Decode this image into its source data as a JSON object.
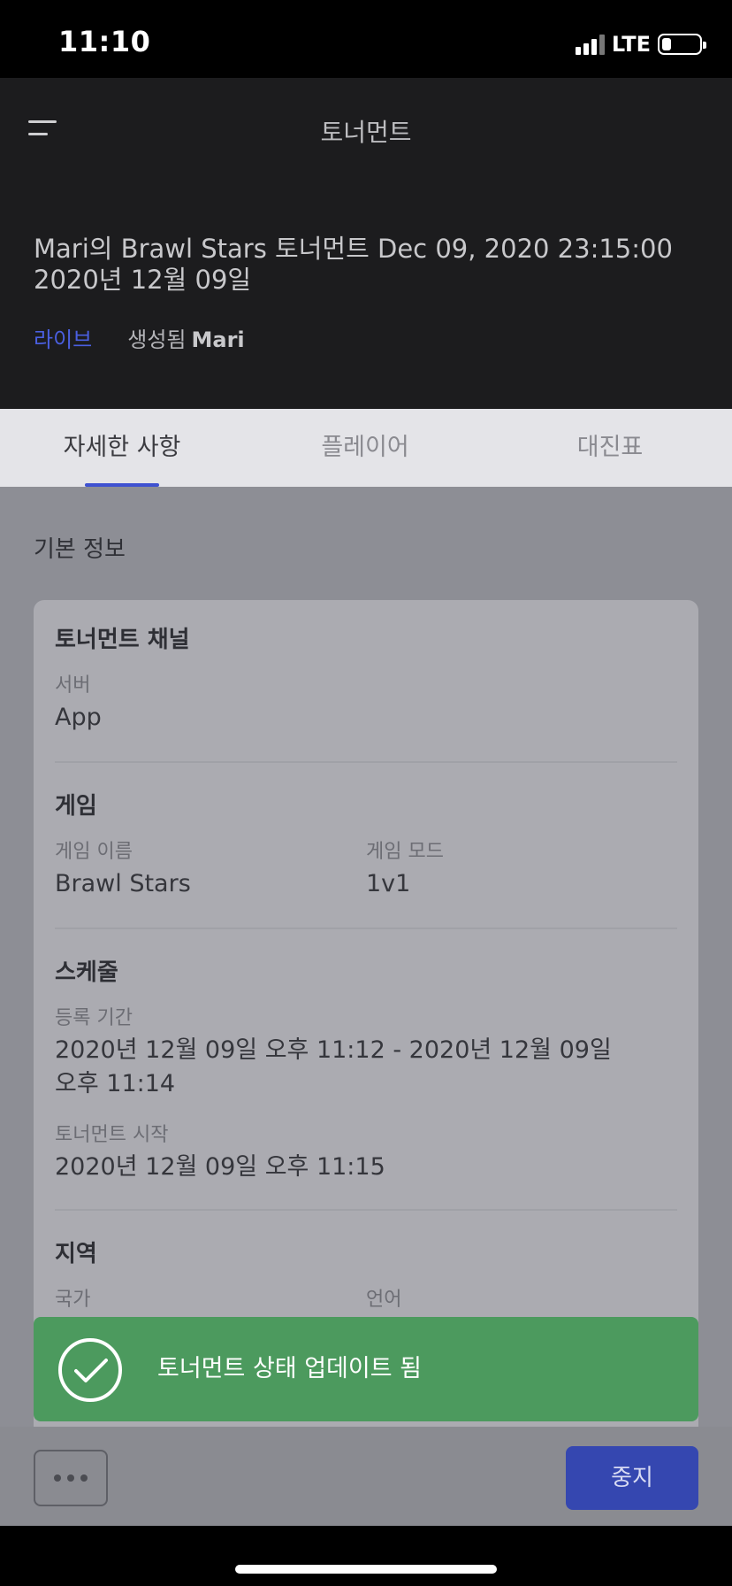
{
  "status_bar": {
    "time": "11:10",
    "network": "LTE"
  },
  "header": {
    "nav_title": "토너먼트",
    "tournament_name": "Mari의 Brawl Stars 토너먼트 Dec 09, 2020 23:15:00 2020년 12월 09일",
    "status": "라이브",
    "created_label": "생성됨",
    "creator": "Mari"
  },
  "tabs": [
    {
      "label": "자세한 사항",
      "active": true
    },
    {
      "label": "플레이어",
      "active": false
    },
    {
      "label": "대진표",
      "active": false
    }
  ],
  "main": {
    "section_title": "기본 정보",
    "channel": {
      "title": "토너먼트 채널",
      "server_label": "서버",
      "server_value": "App"
    },
    "game": {
      "title": "게임",
      "name_label": "게임 이름",
      "name_value": "Brawl Stars",
      "mode_label": "게임 모드",
      "mode_value": "1v1"
    },
    "schedule": {
      "title": "스케줄",
      "registration_label": "등록 기간",
      "registration_value": "2020년 12월 09일 오후 11:12 - 2020년 12월 09일 오후 11:14",
      "start_label": "토너먼트 시작",
      "start_value": "2020년 12월 09일 오후 11:15"
    },
    "region": {
      "title": "지역",
      "country_label": "국가",
      "language_label": "언어"
    }
  },
  "toast": {
    "message": "토너먼트 상태 업데이트 됨"
  },
  "bottom_bar": {
    "stop_label": "중지"
  },
  "colors": {
    "accent": "#3e51d1",
    "live": "#4a5fe0",
    "toast_bg": "#4c9a5e",
    "header_bg": "#1c1c1e"
  }
}
